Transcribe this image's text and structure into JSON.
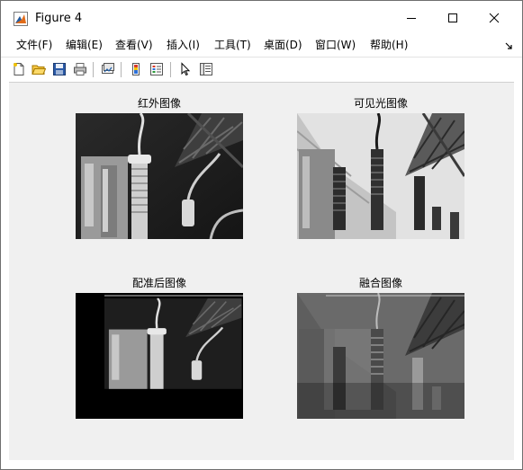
{
  "window": {
    "title": "Figure 4",
    "app_icon": "matlab-logo-icon",
    "controls": {
      "minimize": "minimize-icon",
      "maximize": "maximize-icon",
      "close": "close-icon"
    }
  },
  "menubar": {
    "items": [
      {
        "label": "文件(F)"
      },
      {
        "label": "编辑(E)"
      },
      {
        "label": "查看(V)"
      },
      {
        "label": "插入(I)"
      },
      {
        "label": "工具(T)"
      },
      {
        "label": "桌面(D)"
      },
      {
        "label": "窗口(W)"
      },
      {
        "label": "帮助(H)"
      }
    ],
    "dock_icon": "dock-arrow-icon"
  },
  "toolbar": {
    "buttons": [
      {
        "icon": "new-figure-icon"
      },
      {
        "icon": "open-file-icon"
      },
      {
        "icon": "save-icon"
      },
      {
        "icon": "print-icon"
      },
      {
        "icon": "link-plot-icon"
      },
      {
        "icon": "insert-colorbar-icon"
      },
      {
        "icon": "insert-legend-icon"
      },
      {
        "icon": "select-pointer-icon"
      },
      {
        "icon": "property-editor-icon"
      }
    ]
  },
  "subplots": [
    {
      "title": "红外图像",
      "image": "infrared-image"
    },
    {
      "title": "可见光图像",
      "image": "visible-light-image"
    },
    {
      "title": "配准后图像",
      "image": "registered-image"
    },
    {
      "title": "融合图像",
      "image": "fused-image"
    }
  ],
  "colors": {
    "figure_background": "#f0f0f0",
    "window_background": "#ffffff",
    "matlab_orange": "#e16c19",
    "matlab_blue": "#1f5ea8"
  }
}
